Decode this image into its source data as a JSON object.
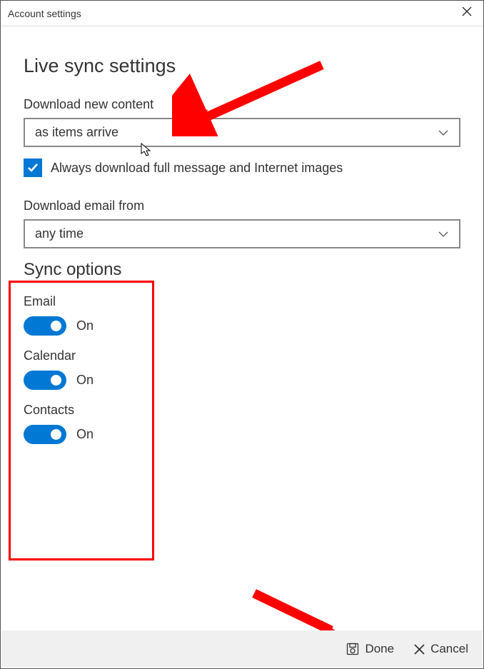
{
  "titlebar": {
    "title": "Account settings"
  },
  "heading": "Live sync settings",
  "download_content": {
    "label": "Download new content",
    "value": "as items arrive"
  },
  "full_message_checkbox": {
    "checked": true,
    "label": "Always download full message and Internet images"
  },
  "download_from": {
    "label": "Download email from",
    "value": "any time"
  },
  "sync_options": {
    "heading": "Sync options",
    "email": {
      "label": "Email",
      "state": "On",
      "on": true
    },
    "calendar": {
      "label": "Calendar",
      "state": "On",
      "on": true
    },
    "contacts": {
      "label": "Contacts",
      "state": "On",
      "on": true
    }
  },
  "buttons": {
    "done": "Done",
    "cancel": "Cancel"
  },
  "colors": {
    "accent": "#0078d4",
    "highlight": "#ff0000"
  }
}
